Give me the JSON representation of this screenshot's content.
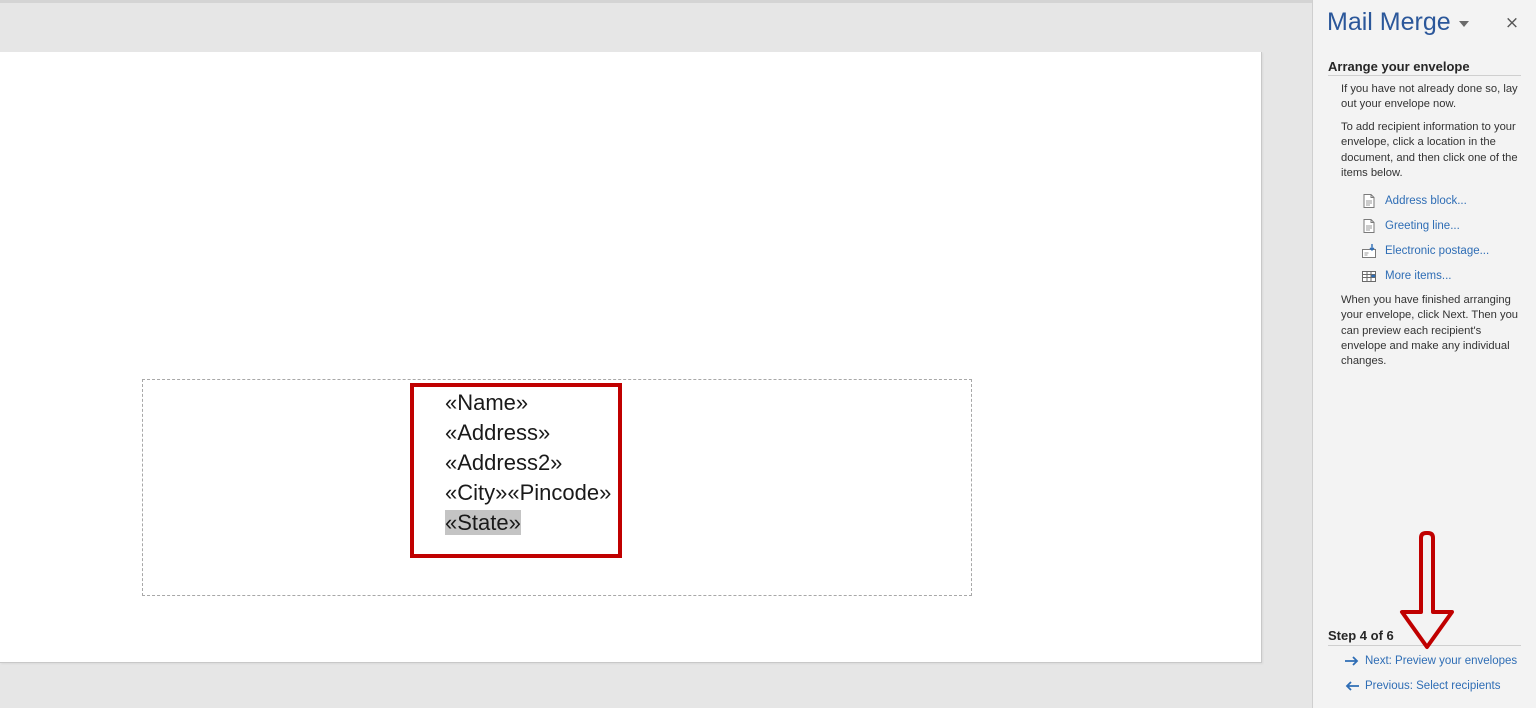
{
  "document": {
    "fields": [
      {
        "text": "«Name»"
      },
      {
        "text": "«Address»"
      },
      {
        "text": "«Address2»"
      },
      {
        "text": "«City»«Pincode»"
      },
      {
        "text": "«State»"
      }
    ],
    "selected_field": "«State»"
  },
  "pane": {
    "title": "Mail Merge",
    "close_glyph": "×",
    "section_title": "Arrange your envelope",
    "intro": "If you have not already done so, lay out your envelope now.",
    "instructions": "To add recipient information to your envelope, click a location in the document, and then click one of the items below.",
    "items": [
      {
        "label": "Address block...",
        "icon": "document-icon"
      },
      {
        "label": "Greeting line...",
        "icon": "document-icon"
      },
      {
        "label": "Electronic postage...",
        "icon": "postage-icon"
      },
      {
        "label": "More items...",
        "icon": "table-icon"
      }
    ],
    "finish_text": "When you have finished arranging your envelope, click Next. Then you can preview each recipient's envelope and make any individual changes.",
    "step": "Step 4 of 6",
    "next_label": "Next: Preview your envelopes",
    "prev_label": "Previous: Select recipients"
  },
  "colors": {
    "accent": "#2b579a",
    "link": "#2e6db5",
    "highlight_border": "#c00000",
    "pane_bg": "#f3f3f3",
    "workspace_bg": "#e6e6e6"
  }
}
